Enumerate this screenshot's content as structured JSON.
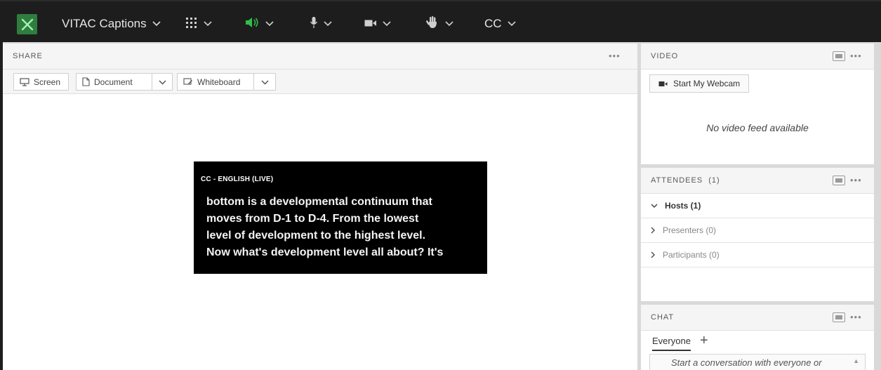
{
  "toolbar": {
    "room_name": "VITAC Captions",
    "cc_label": "CC"
  },
  "share": {
    "title": "SHARE",
    "more": "•••",
    "buttons": {
      "screen": "Screen",
      "document": "Document",
      "whiteboard": "Whiteboard"
    }
  },
  "caption": {
    "label": "CC - ENGLISH (LIVE)",
    "lines": [
      "bottom is a developmental continuum that",
      "moves from D-1 to D-4. From the lowest",
      "level of development to the highest level.",
      "Now what's development level all about? It's"
    ]
  },
  "video": {
    "title": "VIDEO",
    "more": "•••",
    "webcam_button": "Start My Webcam",
    "empty_message": "No video feed available"
  },
  "attendees": {
    "title": "ATTENDEES",
    "count": "(1)",
    "more": "•••",
    "groups": [
      {
        "label": "Hosts (1)",
        "expanded": true
      },
      {
        "label": "Presenters (0)",
        "expanded": false
      },
      {
        "label": "Participants (0)",
        "expanded": false
      }
    ]
  },
  "chat": {
    "title": "CHAT",
    "more": "•••",
    "tab": "Everyone",
    "add_tab": "+",
    "placeholder": "Start a conversation with everyone or"
  },
  "colors": {
    "toolbar_bg": "#1d1d1d",
    "audio_active": "#2fbf4a",
    "caption_bg": "#000000",
    "logo_bg": "#2f7d3f"
  }
}
